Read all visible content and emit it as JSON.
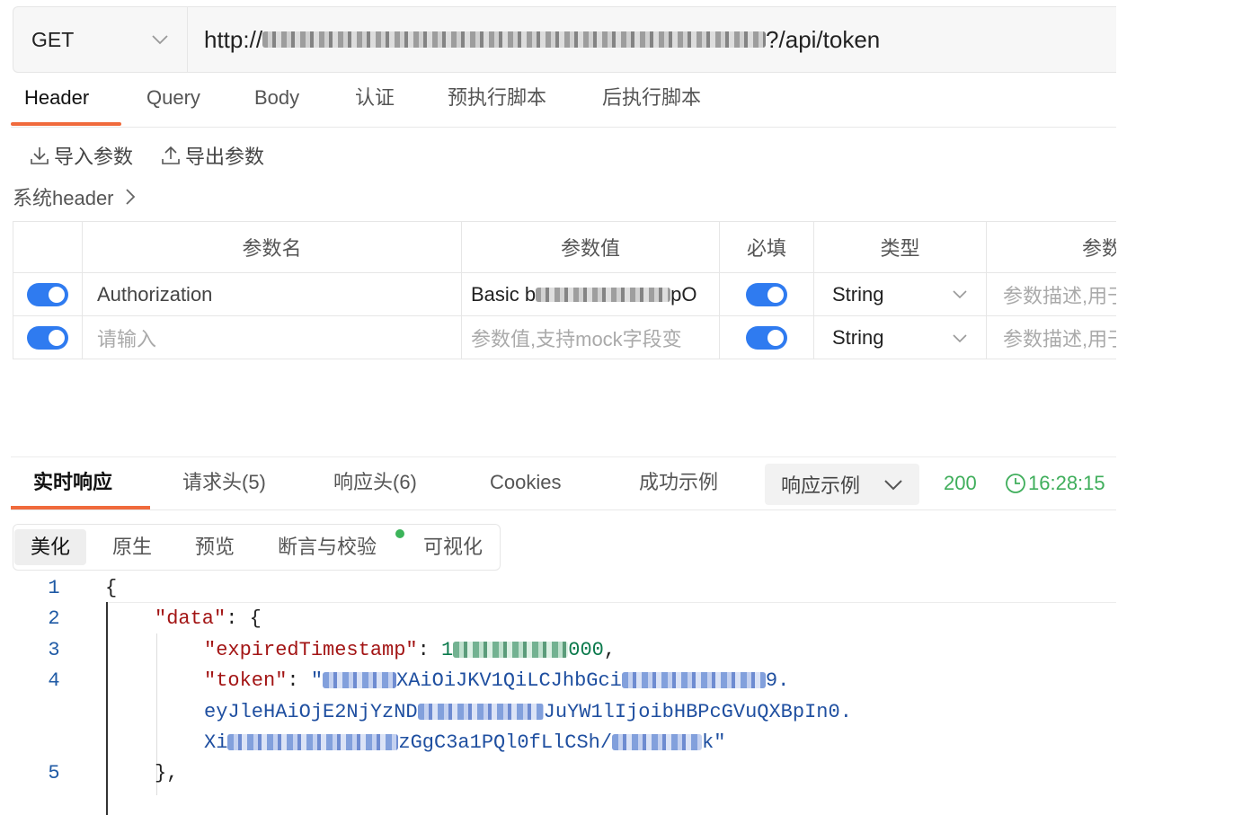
{
  "request": {
    "method": "GET",
    "url_prefix": "http://",
    "url_suffix": "?/api/token"
  },
  "tabs": [
    "Header",
    "Query",
    "Body",
    "认证",
    "预执行脚本",
    "后执行脚本"
  ],
  "actions": {
    "import_label": "导入参数",
    "export_label": "导出参数"
  },
  "system_header": "系统header",
  "params_table": {
    "columns": [
      "参数名",
      "参数值",
      "必填",
      "类型",
      "参数"
    ],
    "rows": [
      {
        "enabled": true,
        "name": "Authorization",
        "value_prefix": "Basic b",
        "value_suffix": "pO",
        "required": true,
        "type": "String",
        "description_placeholder": "参数描述,用于"
      },
      {
        "enabled": true,
        "name_placeholder": "请输入",
        "value_placeholder": "参数值,支持mock字段变",
        "required": true,
        "type": "String",
        "description_placeholder": "参数描述,用于"
      }
    ]
  },
  "response": {
    "tabs": [
      "实时响应",
      "请求头(5)",
      "响应头(6)",
      "Cookies",
      "成功示例"
    ],
    "example_dropdown": "响应示例",
    "status": "200",
    "time": "16:28:15",
    "view_tabs": [
      "美化",
      "原生",
      "预览",
      "断言与校验",
      "可视化"
    ],
    "code": {
      "line_numbers": [
        "1",
        "2",
        "3",
        "4",
        "5"
      ],
      "line1": "{",
      "data_key": "\"data\"",
      "data_open": ": {",
      "expired_key": "\"expiredTimestamp\"",
      "expired_prefix": "1",
      "expired_suffix": "000",
      "token_key": "\"token\"",
      "token_part1_prefix": "\"",
      "token_part1": "XAiOiJKV1QiLCJhbGci",
      "token_part1_suffix": "9.",
      "token_part2_prefix": "eyJleHAiOjE2NjYzND",
      "token_part2_suffix": "JuYW1lIjoibHBPcGVuQXBpIn0.",
      "token_part3_prefix": "Xi",
      "token_part3_mid": "zGgC3a1PQl0fLlCSh/",
      "token_part3_suffix": "k\"",
      "line5": "},"
    }
  },
  "colors": {
    "accent": "#f06a3c",
    "toggle": "#2f7bf0",
    "success": "#3fae5b",
    "json_key": "#a31515",
    "json_string": "#1f4fa0"
  }
}
